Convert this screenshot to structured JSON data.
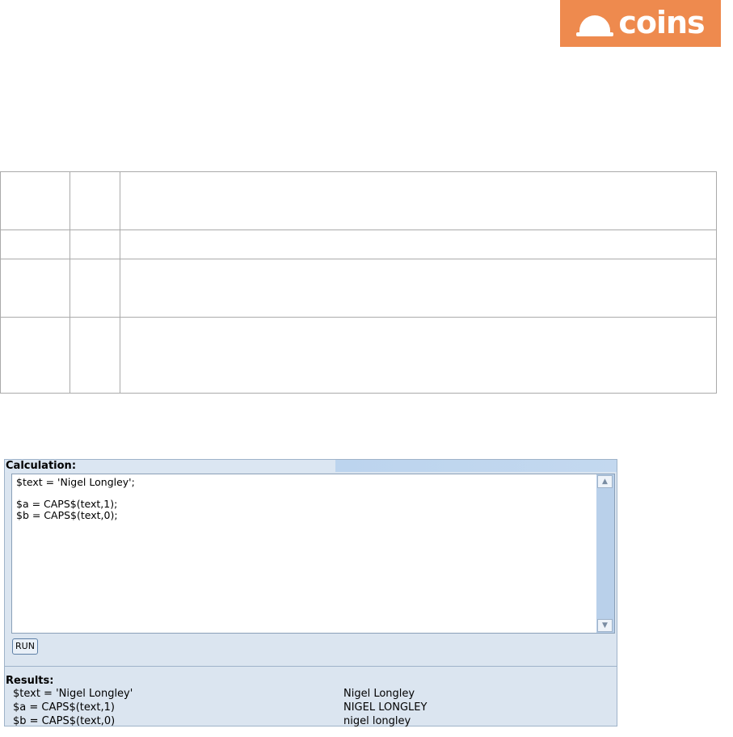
{
  "logo": {
    "text": "coins",
    "color": "#ee8a4e"
  },
  "calculator": {
    "header": "Calculation:",
    "code_lines": [
      "$text = 'Nigel Longley';",
      "",
      "$a = CAPS$(text,1);",
      "$b = CAPS$(text,0);"
    ],
    "run_label": "RUN",
    "results_title": "Results:",
    "results": [
      {
        "expr": "$text = 'Nigel Longley'",
        "value": "Nigel Longley"
      },
      {
        "expr": "$a = CAPS$(text,1)",
        "value": "NIGEL LONGLEY"
      },
      {
        "expr": "$b = CAPS$(text,0)",
        "value": "nigel longley"
      }
    ]
  },
  "colors": {
    "panel_bg": "#dbe5f0",
    "scrollbar": "#b9d0ea",
    "accent": "#ee8a4e"
  }
}
